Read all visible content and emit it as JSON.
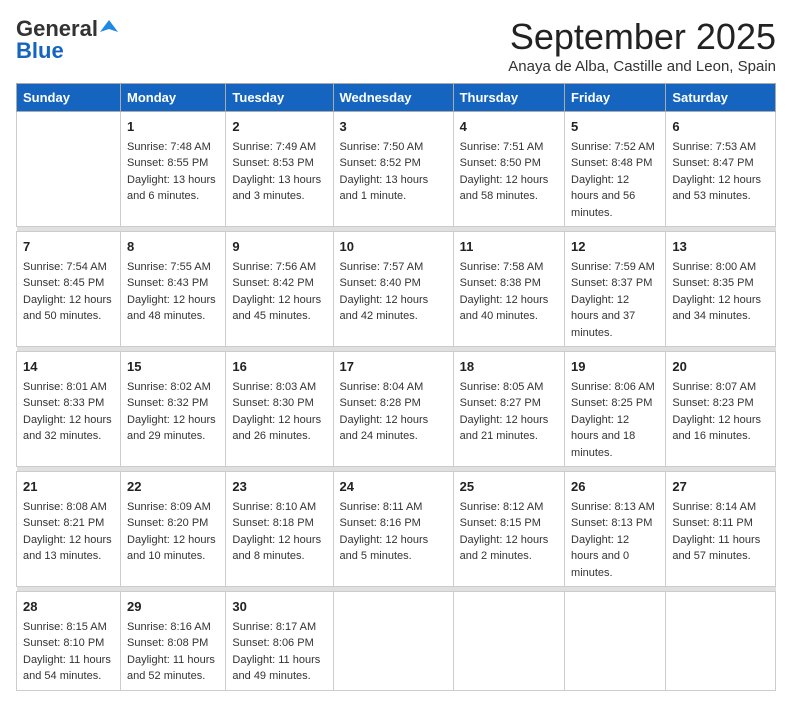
{
  "logo": {
    "general": "General",
    "blue": "Blue"
  },
  "header": {
    "month": "September 2025",
    "location": "Anaya de Alba, Castille and Leon, Spain"
  },
  "days_of_week": [
    "Sunday",
    "Monday",
    "Tuesday",
    "Wednesday",
    "Thursday",
    "Friday",
    "Saturday"
  ],
  "weeks": [
    [
      {
        "day": "",
        "sunrise": "",
        "sunset": "",
        "daylight": ""
      },
      {
        "day": "1",
        "sunrise": "Sunrise: 7:48 AM",
        "sunset": "Sunset: 8:55 PM",
        "daylight": "Daylight: 13 hours and 6 minutes."
      },
      {
        "day": "2",
        "sunrise": "Sunrise: 7:49 AM",
        "sunset": "Sunset: 8:53 PM",
        "daylight": "Daylight: 13 hours and 3 minutes."
      },
      {
        "day": "3",
        "sunrise": "Sunrise: 7:50 AM",
        "sunset": "Sunset: 8:52 PM",
        "daylight": "Daylight: 13 hours and 1 minute."
      },
      {
        "day": "4",
        "sunrise": "Sunrise: 7:51 AM",
        "sunset": "Sunset: 8:50 PM",
        "daylight": "Daylight: 12 hours and 58 minutes."
      },
      {
        "day": "5",
        "sunrise": "Sunrise: 7:52 AM",
        "sunset": "Sunset: 8:48 PM",
        "daylight": "Daylight: 12 hours and 56 minutes."
      },
      {
        "day": "6",
        "sunrise": "Sunrise: 7:53 AM",
        "sunset": "Sunset: 8:47 PM",
        "daylight": "Daylight: 12 hours and 53 minutes."
      }
    ],
    [
      {
        "day": "7",
        "sunrise": "Sunrise: 7:54 AM",
        "sunset": "Sunset: 8:45 PM",
        "daylight": "Daylight: 12 hours and 50 minutes."
      },
      {
        "day": "8",
        "sunrise": "Sunrise: 7:55 AM",
        "sunset": "Sunset: 8:43 PM",
        "daylight": "Daylight: 12 hours and 48 minutes."
      },
      {
        "day": "9",
        "sunrise": "Sunrise: 7:56 AM",
        "sunset": "Sunset: 8:42 PM",
        "daylight": "Daylight: 12 hours and 45 minutes."
      },
      {
        "day": "10",
        "sunrise": "Sunrise: 7:57 AM",
        "sunset": "Sunset: 8:40 PM",
        "daylight": "Daylight: 12 hours and 42 minutes."
      },
      {
        "day": "11",
        "sunrise": "Sunrise: 7:58 AM",
        "sunset": "Sunset: 8:38 PM",
        "daylight": "Daylight: 12 hours and 40 minutes."
      },
      {
        "day": "12",
        "sunrise": "Sunrise: 7:59 AM",
        "sunset": "Sunset: 8:37 PM",
        "daylight": "Daylight: 12 hours and 37 minutes."
      },
      {
        "day": "13",
        "sunrise": "Sunrise: 8:00 AM",
        "sunset": "Sunset: 8:35 PM",
        "daylight": "Daylight: 12 hours and 34 minutes."
      }
    ],
    [
      {
        "day": "14",
        "sunrise": "Sunrise: 8:01 AM",
        "sunset": "Sunset: 8:33 PM",
        "daylight": "Daylight: 12 hours and 32 minutes."
      },
      {
        "day": "15",
        "sunrise": "Sunrise: 8:02 AM",
        "sunset": "Sunset: 8:32 PM",
        "daylight": "Daylight: 12 hours and 29 minutes."
      },
      {
        "day": "16",
        "sunrise": "Sunrise: 8:03 AM",
        "sunset": "Sunset: 8:30 PM",
        "daylight": "Daylight: 12 hours and 26 minutes."
      },
      {
        "day": "17",
        "sunrise": "Sunrise: 8:04 AM",
        "sunset": "Sunset: 8:28 PM",
        "daylight": "Daylight: 12 hours and 24 minutes."
      },
      {
        "day": "18",
        "sunrise": "Sunrise: 8:05 AM",
        "sunset": "Sunset: 8:27 PM",
        "daylight": "Daylight: 12 hours and 21 minutes."
      },
      {
        "day": "19",
        "sunrise": "Sunrise: 8:06 AM",
        "sunset": "Sunset: 8:25 PM",
        "daylight": "Daylight: 12 hours and 18 minutes."
      },
      {
        "day": "20",
        "sunrise": "Sunrise: 8:07 AM",
        "sunset": "Sunset: 8:23 PM",
        "daylight": "Daylight: 12 hours and 16 minutes."
      }
    ],
    [
      {
        "day": "21",
        "sunrise": "Sunrise: 8:08 AM",
        "sunset": "Sunset: 8:21 PM",
        "daylight": "Daylight: 12 hours and 13 minutes."
      },
      {
        "day": "22",
        "sunrise": "Sunrise: 8:09 AM",
        "sunset": "Sunset: 8:20 PM",
        "daylight": "Daylight: 12 hours and 10 minutes."
      },
      {
        "day": "23",
        "sunrise": "Sunrise: 8:10 AM",
        "sunset": "Sunset: 8:18 PM",
        "daylight": "Daylight: 12 hours and 8 minutes."
      },
      {
        "day": "24",
        "sunrise": "Sunrise: 8:11 AM",
        "sunset": "Sunset: 8:16 PM",
        "daylight": "Daylight: 12 hours and 5 minutes."
      },
      {
        "day": "25",
        "sunrise": "Sunrise: 8:12 AM",
        "sunset": "Sunset: 8:15 PM",
        "daylight": "Daylight: 12 hours and 2 minutes."
      },
      {
        "day": "26",
        "sunrise": "Sunrise: 8:13 AM",
        "sunset": "Sunset: 8:13 PM",
        "daylight": "Daylight: 12 hours and 0 minutes."
      },
      {
        "day": "27",
        "sunrise": "Sunrise: 8:14 AM",
        "sunset": "Sunset: 8:11 PM",
        "daylight": "Daylight: 11 hours and 57 minutes."
      }
    ],
    [
      {
        "day": "28",
        "sunrise": "Sunrise: 8:15 AM",
        "sunset": "Sunset: 8:10 PM",
        "daylight": "Daylight: 11 hours and 54 minutes."
      },
      {
        "day": "29",
        "sunrise": "Sunrise: 8:16 AM",
        "sunset": "Sunset: 8:08 PM",
        "daylight": "Daylight: 11 hours and 52 minutes."
      },
      {
        "day": "30",
        "sunrise": "Sunrise: 8:17 AM",
        "sunset": "Sunset: 8:06 PM",
        "daylight": "Daylight: 11 hours and 49 minutes."
      },
      {
        "day": "",
        "sunrise": "",
        "sunset": "",
        "daylight": ""
      },
      {
        "day": "",
        "sunrise": "",
        "sunset": "",
        "daylight": ""
      },
      {
        "day": "",
        "sunrise": "",
        "sunset": "",
        "daylight": ""
      },
      {
        "day": "",
        "sunrise": "",
        "sunset": "",
        "daylight": ""
      }
    ]
  ]
}
